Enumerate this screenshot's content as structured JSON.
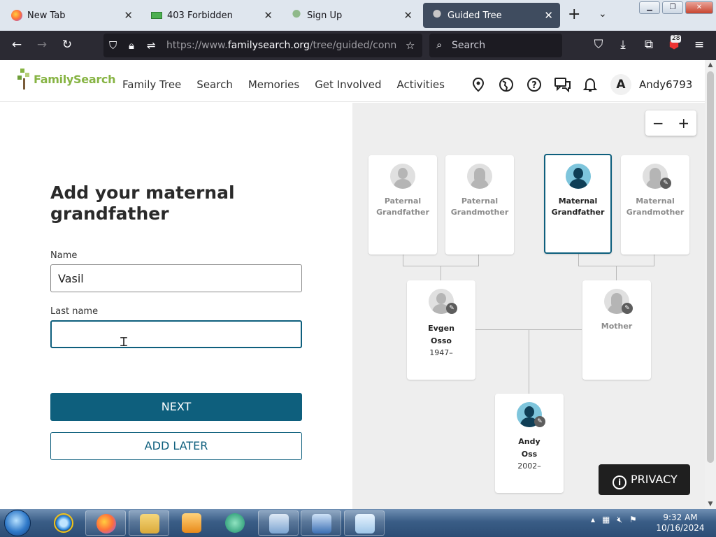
{
  "browser": {
    "tabs": [
      {
        "label": "New Tab",
        "close": "✕"
      },
      {
        "label": "403 Forbidden",
        "close": "✕"
      },
      {
        "label": "Sign Up",
        "close": "✕"
      },
      {
        "label": "Guided Tree",
        "close": "✕"
      }
    ],
    "active_tab_index": 3,
    "url_prefix": "https://www.",
    "url_host": "familysearch.org",
    "url_path": "/tree/guided/connect-to-f",
    "search_placeholder": "Search",
    "extension_badge": "28"
  },
  "site": {
    "logo_text": "FamilySearch",
    "menu": [
      "Family Tree",
      "Search",
      "Memories",
      "Get Involved",
      "Activities"
    ],
    "avatar_initial": "A",
    "username": "Andy6793"
  },
  "form": {
    "title": "Add your maternal grandfather",
    "name_label": "Name",
    "name_value": "Vasil",
    "lastname_label": "Last name",
    "lastname_value": "",
    "next_label": "NEXT",
    "later_label": "ADD LATER"
  },
  "tree": {
    "zoom_out": "−",
    "zoom_in": "+",
    "people": [
      {
        "id": "paternal-grandfather",
        "name": "Paternal Grandfather",
        "dates": "",
        "gender": "male",
        "selected": false,
        "editable": false
      },
      {
        "id": "paternal-grandmother",
        "name": "Paternal Grandmother",
        "dates": "",
        "gender": "female",
        "selected": false,
        "editable": false
      },
      {
        "id": "maternal-grandfather",
        "name": "Maternal Grandfather",
        "dates": "",
        "gender": "male",
        "selected": true,
        "editable": false
      },
      {
        "id": "maternal-grandmother",
        "name": "Maternal Grandmother",
        "dates": "",
        "gender": "female",
        "selected": false,
        "editable": true
      },
      {
        "id": "father",
        "name_line1": "Evgen",
        "name_line2": "Osso",
        "dates": "1947–",
        "gender": "male",
        "selected": false,
        "editable": true
      },
      {
        "id": "mother",
        "name": "Mother",
        "dates": "",
        "gender": "female",
        "selected": false,
        "editable": true
      },
      {
        "id": "self",
        "name_line1": "Andy",
        "name_line2": "Oss",
        "dates": "2002–",
        "gender": "male",
        "selected": false,
        "editable": true
      }
    ]
  },
  "privacy_label": "PRIVACY",
  "taskbar": {
    "time": "9:32 AM",
    "date": "10/16/2024"
  },
  "colors": {
    "primary": "#0e5f7d",
    "logo_green": "#87b444",
    "tree_bg": "#eeeeee",
    "browser_dark": "#2b2a33"
  }
}
